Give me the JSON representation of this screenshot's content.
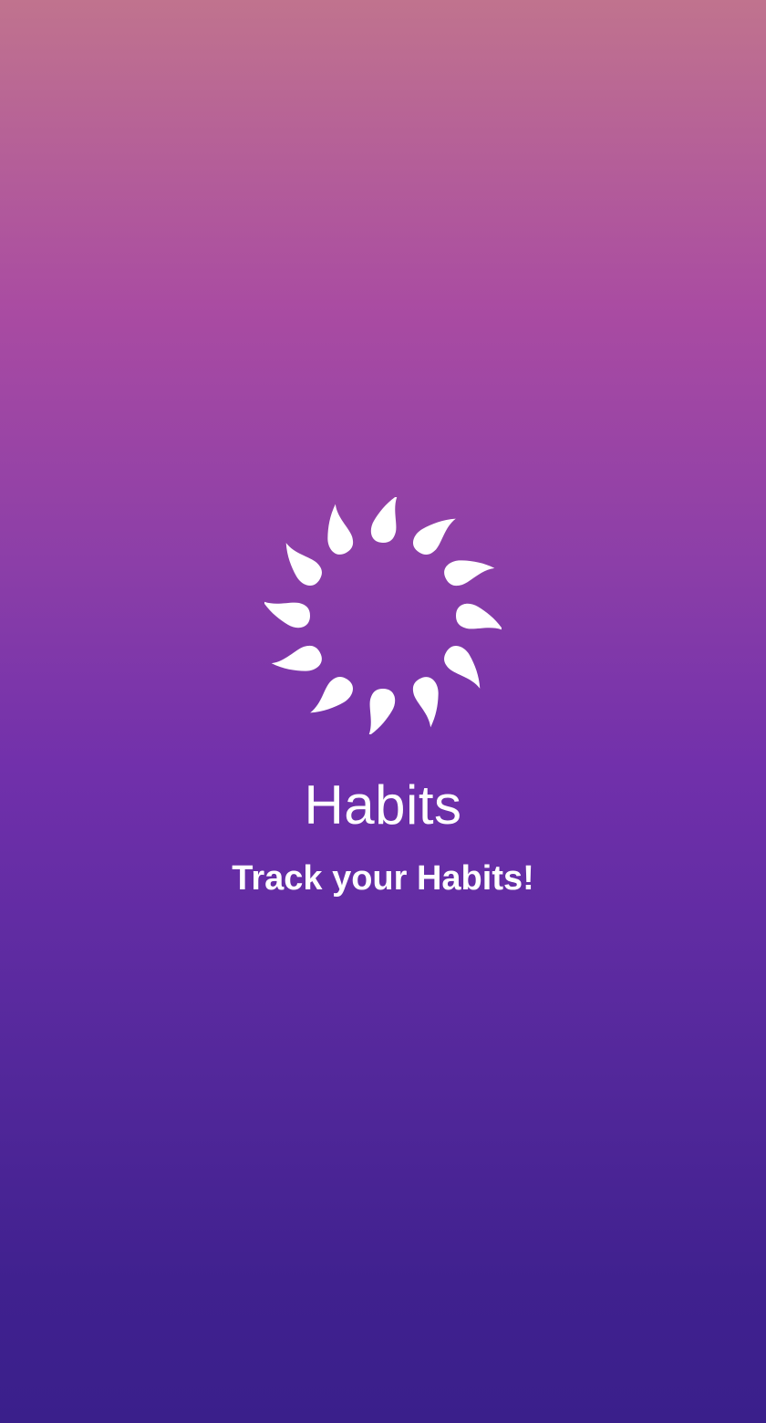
{
  "splash": {
    "logo_icon": "swirl-droplets-icon",
    "title": "Habits",
    "tagline": "Track your Habits!"
  },
  "colors": {
    "gradient_top": "#c0738e",
    "gradient_mid": "#7130ab",
    "gradient_bottom": "#3a1f8b",
    "text": "#ffffff"
  }
}
